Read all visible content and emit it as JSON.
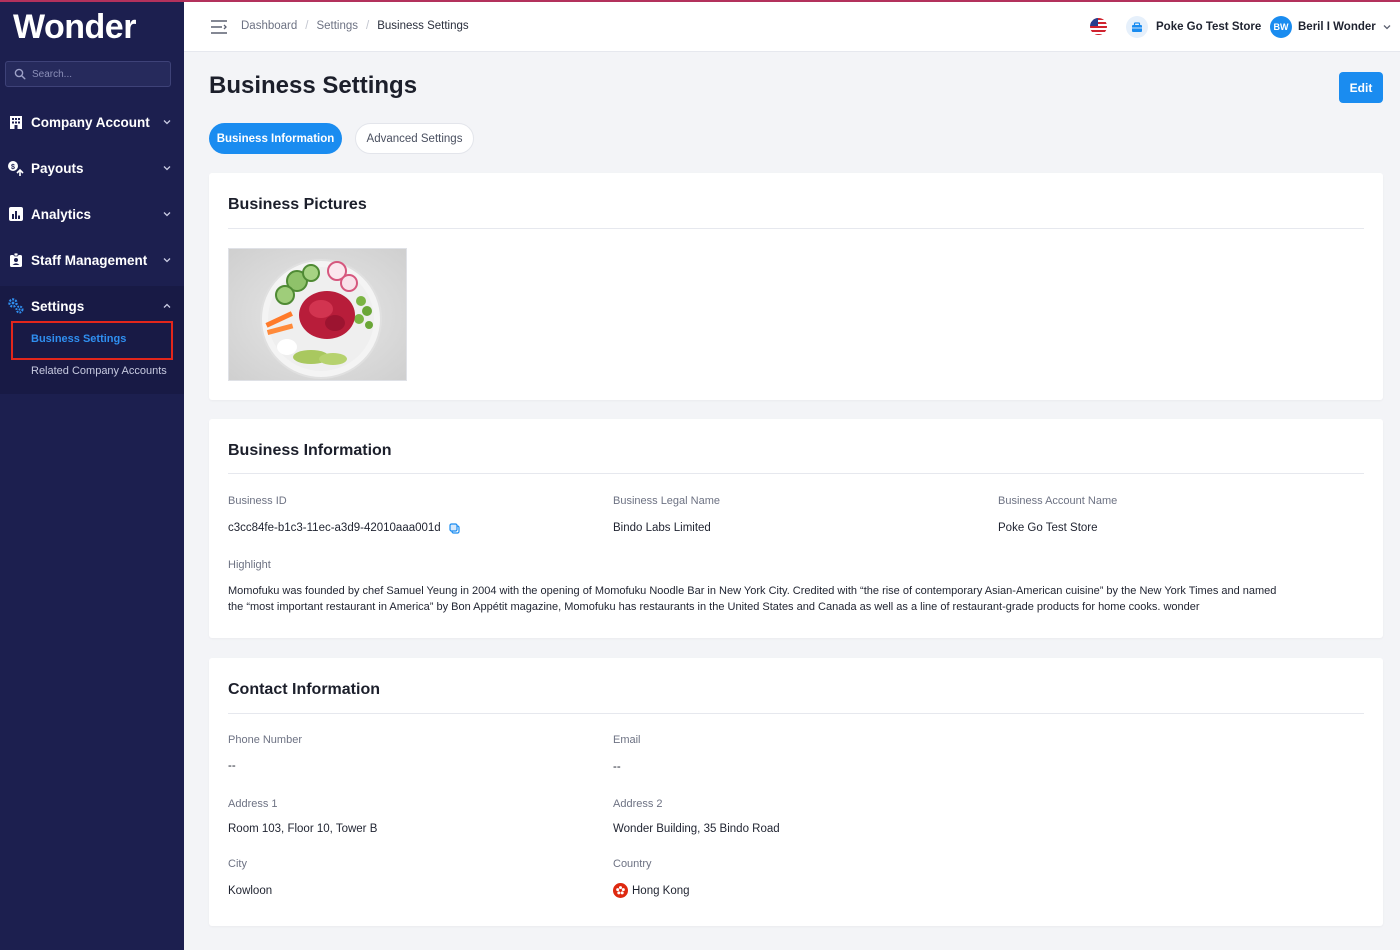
{
  "sidebar": {
    "brand": "Wonder",
    "search_placeholder": "Search...",
    "items": [
      {
        "label": "Company Account",
        "icon": "building-icon"
      },
      {
        "label": "Payouts",
        "icon": "payouts-icon"
      },
      {
        "label": "Analytics",
        "icon": "analytics-icon"
      },
      {
        "label": "Staff Management",
        "icon": "staff-icon"
      },
      {
        "label": "Settings",
        "icon": "gears-icon"
      }
    ],
    "settings_sub": [
      {
        "label": "Business Settings",
        "active": true
      },
      {
        "label": "Related Company Accounts",
        "active": false
      }
    ]
  },
  "topbar": {
    "breadcrumb": [
      "Dashboard",
      "Settings",
      "Business Settings"
    ],
    "store_name": "Poke Go Test Store",
    "user_initials": "BW",
    "user_name": "Beril I Wonder"
  },
  "page": {
    "title": "Business Settings",
    "edit_label": "Edit",
    "tabs": [
      {
        "label": "Business Information",
        "active": true
      },
      {
        "label": "Advanced Settings",
        "active": false
      }
    ]
  },
  "pictures_card": {
    "title": "Business Pictures"
  },
  "info_card": {
    "title": "Business Information",
    "business_id_label": "Business ID",
    "business_id": "c3cc84fe-b1c3-11ec-a3d9-42010aaa001d",
    "legal_name_label": "Business Legal Name",
    "legal_name": "Bindo Labs Limited",
    "account_name_label": "Business Account Name",
    "account_name": "Poke Go Test Store",
    "highlight_label": "Highlight",
    "highlight_line1": "Momofuku was founded by chef Samuel Yeung in 2004 with the opening of Momofuku Noodle Bar in New York City. Credited with “the rise of contemporary Asian-American cuisine” by the New York Times and named",
    "highlight_line2": "the “most important restaurant in America” by Bon Appétit magazine, Momofuku has restaurants in the United States and Canada as well as a line of restaurant-grade products for home cooks. wonder"
  },
  "contact_card": {
    "title": "Contact Information",
    "phone_label": "Phone Number",
    "phone": "--",
    "email_label": "Email",
    "email": "--",
    "address1_label": "Address 1",
    "address1": "Room 103, Floor 10, Tower B",
    "address2_label": "Address 2",
    "address2": "Wonder Building, 35 Bindo Road",
    "city_label": "City",
    "city": "Kowloon",
    "country_label": "Country",
    "country": "Hong Kong"
  },
  "colors": {
    "sidebar_bg": "#1c1f4f",
    "accent": "#1a8cf0",
    "highlight_box": "#e2261b"
  }
}
